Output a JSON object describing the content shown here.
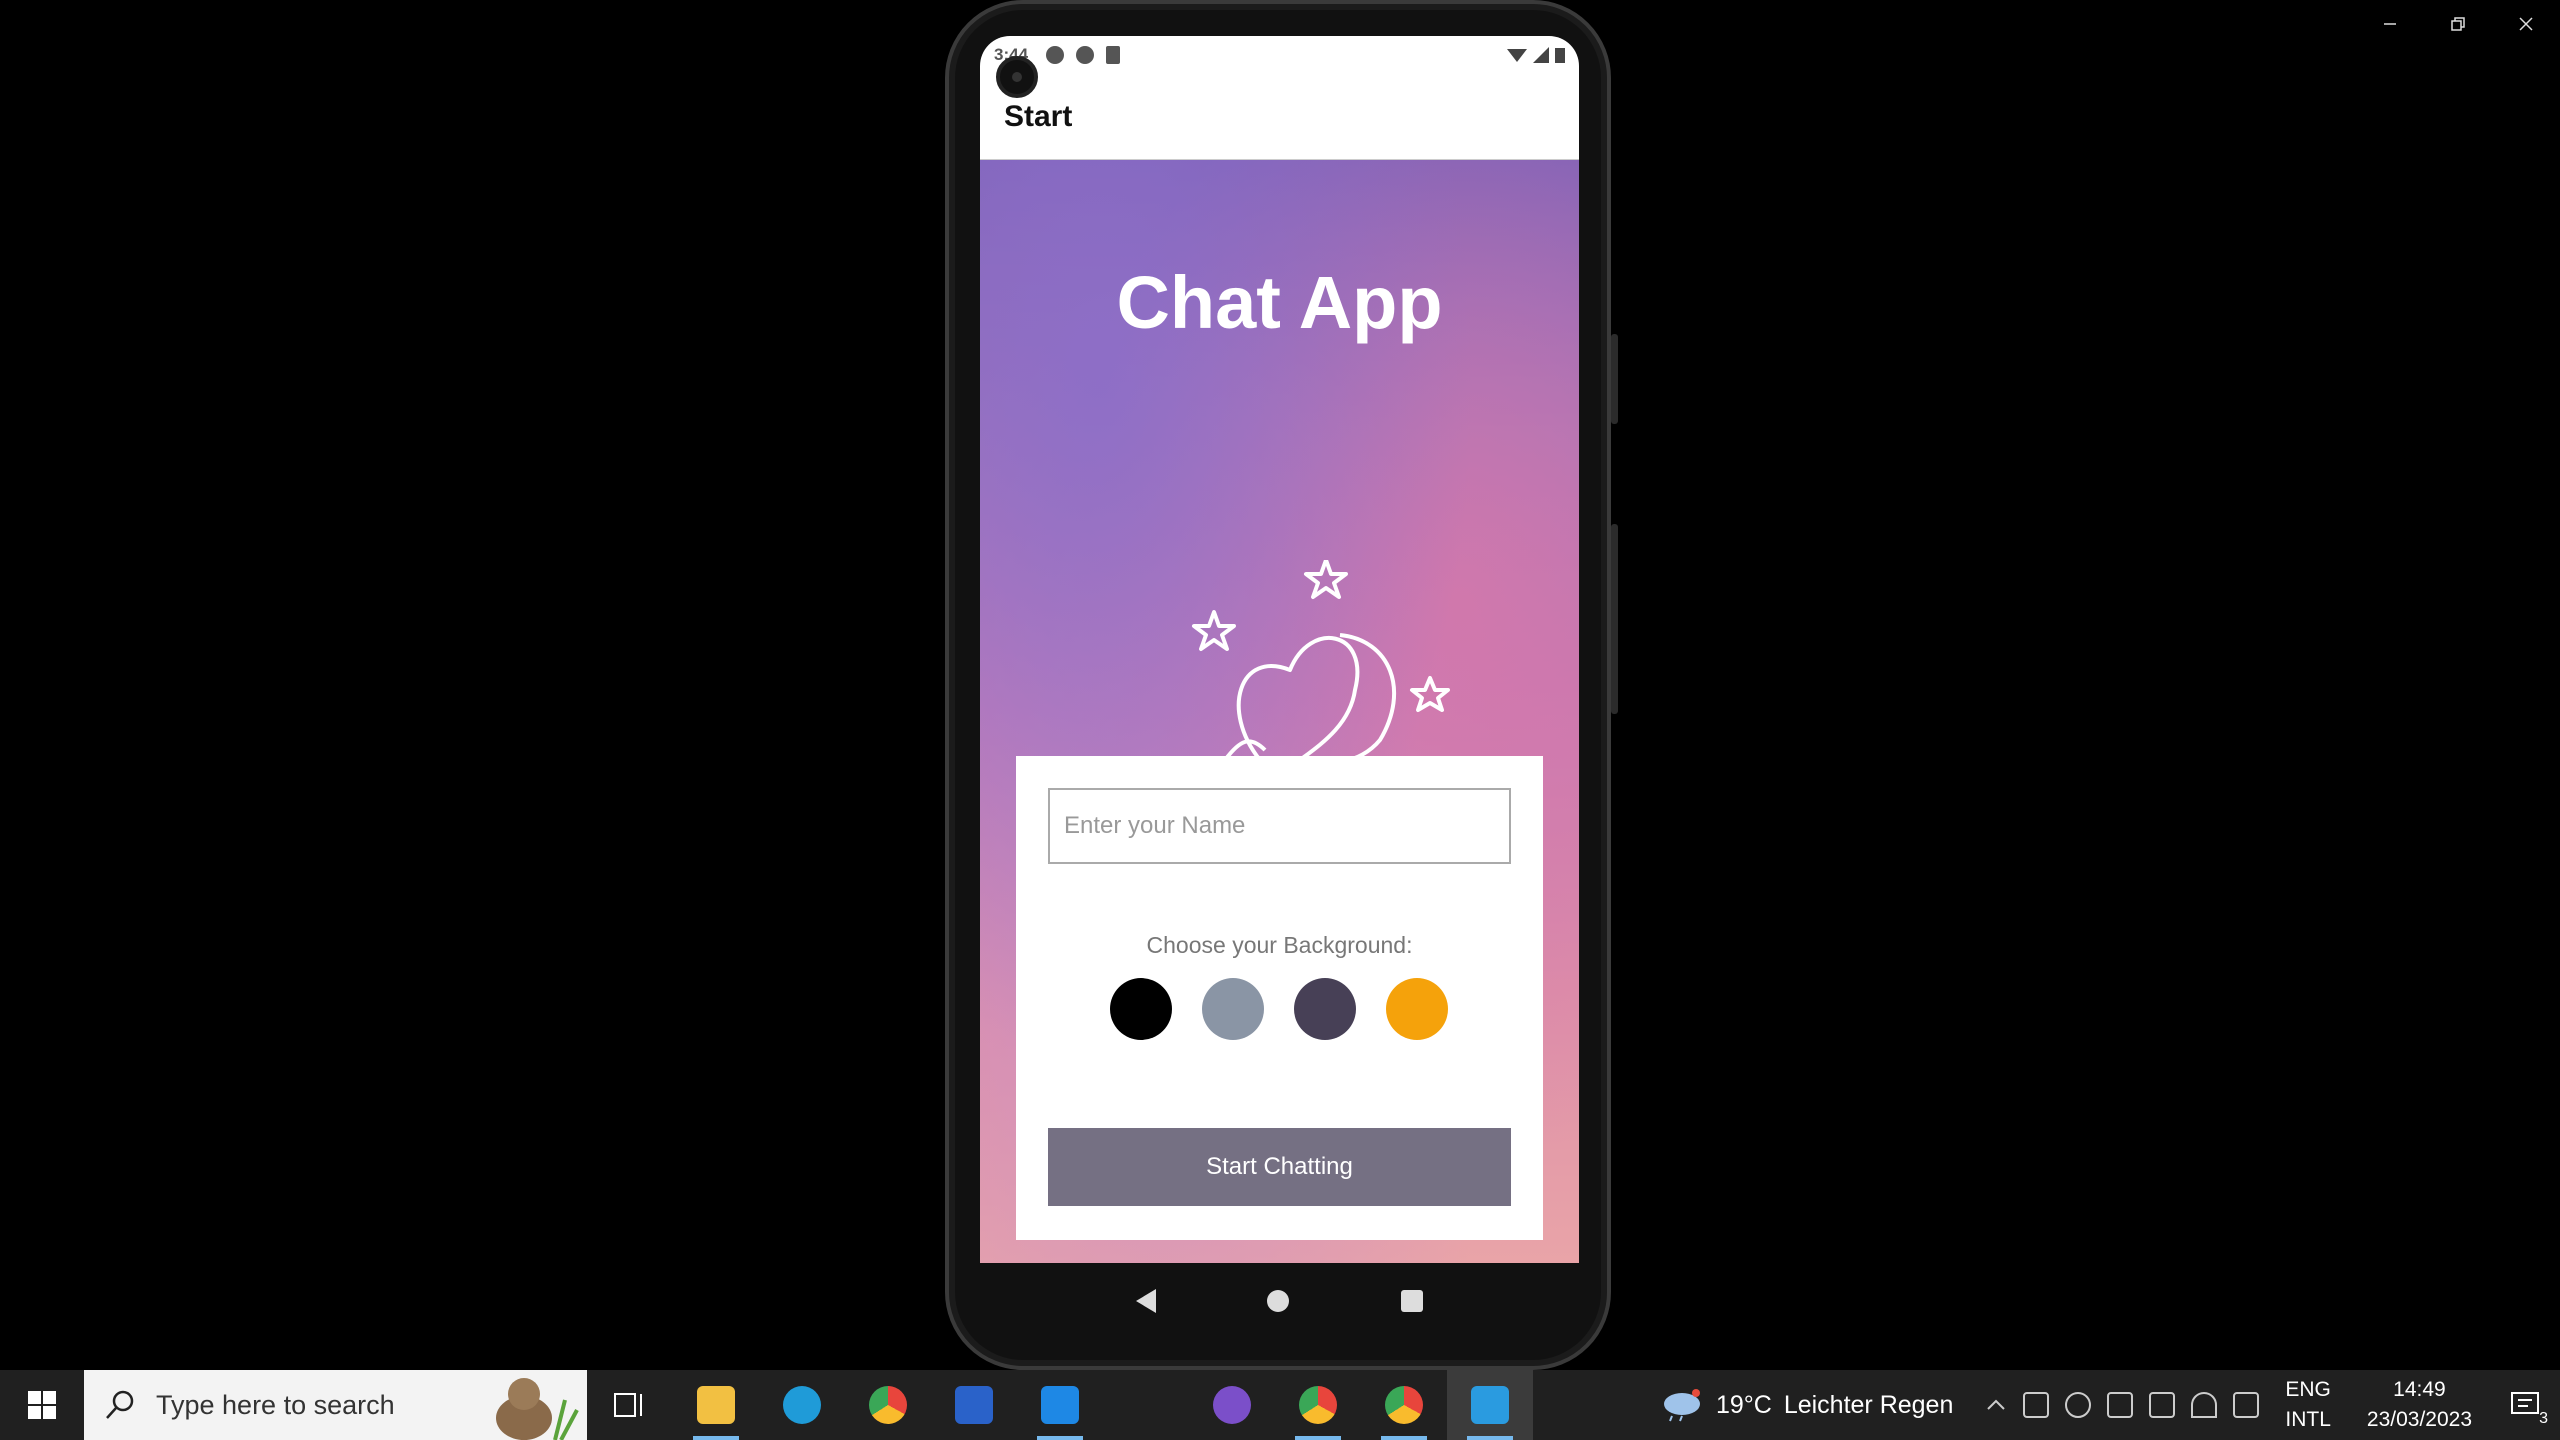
{
  "window": {
    "minimize_icon": "minimize-icon",
    "restore_icon": "restore-icon",
    "close_icon": "close-icon"
  },
  "emulator": {
    "status_bar": {
      "time": "3:44"
    },
    "app_bar": {
      "title": "Start"
    },
    "app": {
      "title": "Chat App",
      "name_input": {
        "value": "",
        "placeholder": "Enter your Name"
      },
      "background_label": "Choose your Background:",
      "background_colors": [
        "#000000",
        "#8a95a5",
        "#474056",
        "#f5a20b"
      ],
      "start_button_label": "Start Chatting",
      "start_button_color": "#757083"
    }
  },
  "taskbar": {
    "search_placeholder": "Type here to search",
    "weather": {
      "temperature": "19°C",
      "description": "Leichter Regen"
    },
    "language": {
      "line1": "ENG",
      "line2": "INTL"
    },
    "clock": {
      "time": "14:49",
      "date": "23/03/2023"
    },
    "notification_count": "3"
  }
}
